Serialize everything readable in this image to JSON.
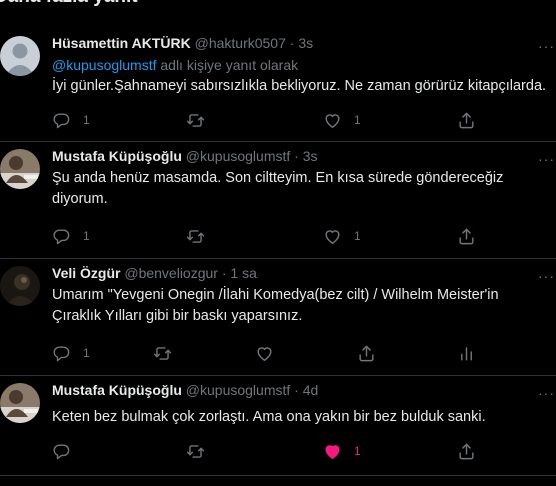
{
  "section_header": "Daha fazla yanıt",
  "tweets": [
    {
      "name": "Hüsamettin AKTÜRK",
      "handle": "@hakturk0507",
      "dot": "·",
      "time": "3s",
      "replying_mention": "@kupusoglumstf",
      "replying_suffix": " adlı kişiye yanıt olarak",
      "text": "İyi günler.Şahnameyi sabırsızlıkla bekliyoruz. Ne zaman görürüz kitapçılarda.",
      "reply_count": "1",
      "retweet_count": "",
      "like_count": "1",
      "more": "···"
    },
    {
      "name": "Mustafa Küpüşoğlu",
      "handle": "@kupusoglumstf",
      "dot": "·",
      "time": "3s",
      "text_line1": "Şu anda henüz masamda. Son ciltteyim. En kısa sürede göndereceğiz",
      "text_line2": "diyorum.",
      "reply_count": "1",
      "retweet_count": "",
      "like_count": "1",
      "more": "···"
    },
    {
      "name": "Veli Özgür",
      "handle": "@benveliozgur",
      "dot": "·",
      "time": "1 sa",
      "text_line1": "Umarım \"Yevgeni Onegin /İlahi Komedya(bez cilt) / Wilhelm Meister'in",
      "text_line2": "Çıraklık Yılları gibi bir baskı yaparsınız.",
      "reply_count": "1",
      "retweet_count": "",
      "like_count": "",
      "more": "···"
    },
    {
      "name": "Mustafa Küpüşoğlu",
      "handle": "@kupusoglumstf",
      "dot": "·",
      "time": "4d",
      "text": "Keten bez bulmak çok zorlaştı. Ama ona yakın bir bez bulduk sanki.",
      "reply_count": "",
      "retweet_count": "",
      "like_count": "1",
      "liked": true,
      "more": "···"
    }
  ],
  "icons": {
    "reply": "reply-icon",
    "retweet": "retweet-icon",
    "like": "heart-icon",
    "share": "share-icon",
    "analytics": "analytics-icon",
    "more": "more-icon"
  },
  "colors": {
    "background": "#000000",
    "text": "#e7e9ea",
    "secondary": "#71767b",
    "link": "#1d9bf0",
    "like": "#f91880",
    "divider": "#2f3336"
  }
}
